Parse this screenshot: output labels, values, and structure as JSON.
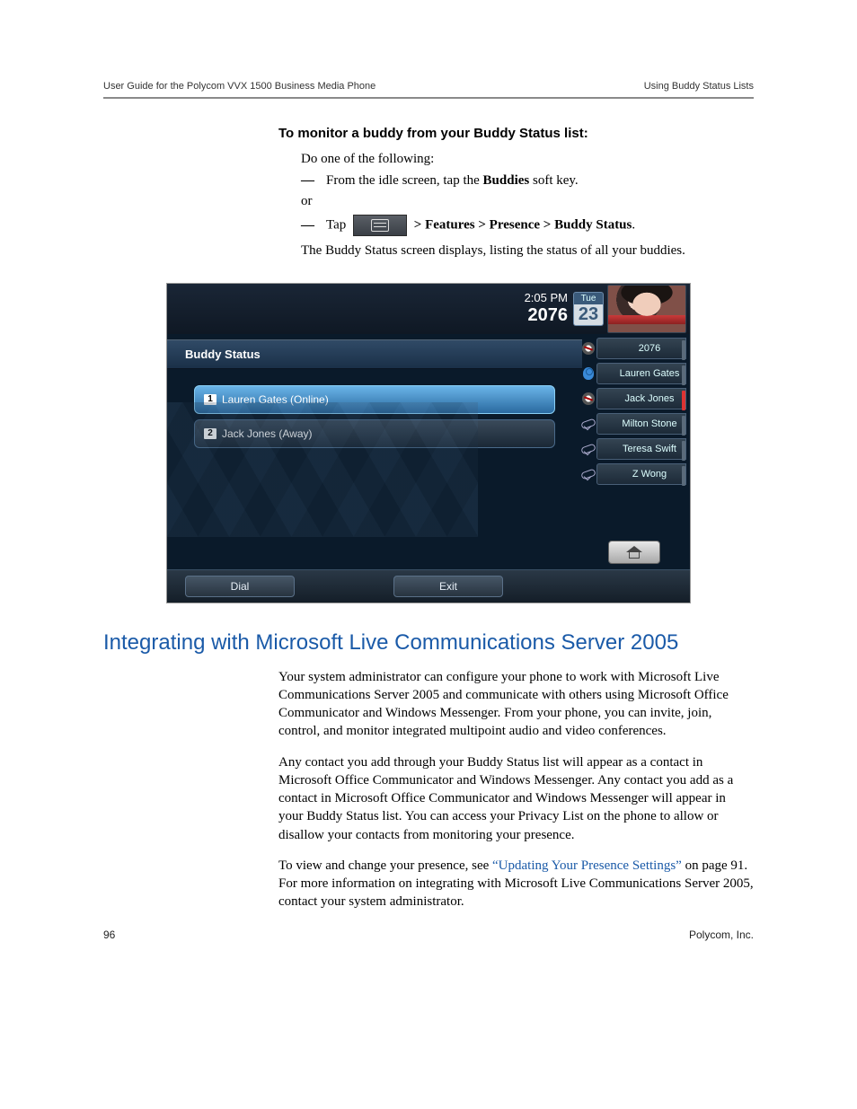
{
  "header": {
    "left": "User Guide for the Polycom VVX 1500 Business Media Phone",
    "right": "Using Buddy Status Lists"
  },
  "procedure": {
    "title": "To monitor a buddy from your Buddy Status list:",
    "intro": "Do one of the following:",
    "bullet1_pre": "From the idle screen, tap the ",
    "bullet1_bold": "Buddies",
    "bullet1_post": " soft key.",
    "or": "or",
    "bullet2_pre": "Tap ",
    "bullet2_path": " > Features > Presence > Buddy Status",
    "bullet2_end": ".",
    "result": "The Buddy Status screen displays, listing the status of all your buddies."
  },
  "screenshot": {
    "time": "2:05 PM",
    "extension": "2076",
    "day": "Tue",
    "date": "23",
    "panel_title": "Buddy Status",
    "rows": [
      {
        "num": "1",
        "label": "Lauren Gates (Online)",
        "selected": true
      },
      {
        "num": "2",
        "label": "Jack Jones (Away)",
        "selected": false
      }
    ],
    "side": [
      {
        "label": "2076",
        "icon": "dnd",
        "strip": "gray"
      },
      {
        "label": "Lauren Gates",
        "icon": "online",
        "strip": "gray"
      },
      {
        "label": "Jack Jones",
        "icon": "dnd",
        "strip": "red"
      },
      {
        "label": "Milton Stone",
        "icon": "phone",
        "strip": "gray"
      },
      {
        "label": "Teresa Swift",
        "icon": "phone",
        "strip": "gray"
      },
      {
        "label": "Z Wong",
        "icon": "phone",
        "strip": "gray"
      }
    ],
    "softkeys": {
      "dial": "Dial",
      "exit": "Exit"
    }
  },
  "section": {
    "heading": "Integrating with Microsoft Live Communications Server 2005",
    "p1": "Your system administrator can configure your phone to work with Microsoft Live Communications Server 2005 and communicate with others using Microsoft Office Communicator and Windows Messenger. From your phone, you can invite, join, control, and monitor integrated multipoint audio and video conferences.",
    "p2": "Any contact you add through your Buddy Status list will appear as a contact in Microsoft Office Communicator and Windows Messenger. Any contact you add as a contact in Microsoft Office Communicator and Windows Messenger will appear in your Buddy Status list. You can access your Privacy List on the phone to allow or disallow your contacts from monitoring your presence.",
    "p3_pre": "To view and change your presence, see ",
    "p3_link": "“Updating Your Presence Settings”",
    "p3_post": " on page 91. For more information on integrating with Microsoft Live Communications Server 2005, contact your system administrator."
  },
  "footer": {
    "page": "96",
    "company": "Polycom, Inc."
  }
}
